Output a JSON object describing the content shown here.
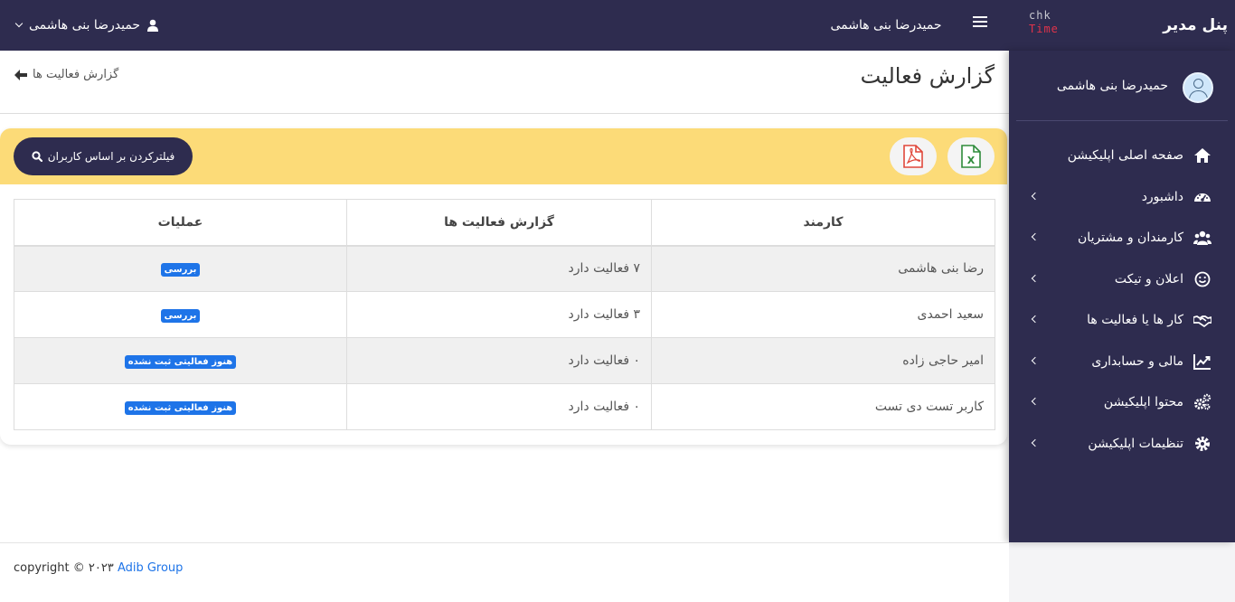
{
  "topbar": {
    "brand": "پنل مدیر",
    "logo_line1": "chk",
    "logo_line2": "Time",
    "user_name": "حمیدرضا بنی هاشمی",
    "user_menu_name": "حمیدرضا بنی هاشمی"
  },
  "sidebar": {
    "profile_name": "حمیدرضا بنی هاشمی",
    "items": [
      {
        "label": "صفحه اصلی اپلیکیشن",
        "icon": "home-icon"
      },
      {
        "label": "داشبورد",
        "icon": "dashboard-icon"
      },
      {
        "label": "کارمندان و مشتریان",
        "icon": "users-icon"
      },
      {
        "label": "اعلان و تیکت",
        "icon": "smile-icon"
      },
      {
        "label": "کار ها یا فعالیت ها",
        "icon": "handshake-icon"
      },
      {
        "label": "مالی و حسابداری",
        "icon": "chart-line-icon"
      },
      {
        "label": "محتوا اپلیکیشن",
        "icon": "cogs-icon"
      },
      {
        "label": "تنظیمات اپلیکیشن",
        "icon": "gear-icon"
      }
    ]
  },
  "page": {
    "title": "گزارش فعالیت",
    "breadcrumb": "گزارش فعالیت ها"
  },
  "toolbar": {
    "filter_label": "فیلترکردن بر اساس کاربران",
    "excel_label": "X"
  },
  "table": {
    "headers": [
      "کارمند",
      "گزارش فعالیت ها",
      "عملیات"
    ],
    "rows": [
      {
        "employee": "رضا بنی هاشمی",
        "activity": "۷ فعالیت دارد",
        "action": "بررسی"
      },
      {
        "employee": "سعید احمدی",
        "activity": "۳ فعالیت دارد",
        "action": "بررسی"
      },
      {
        "employee": "امیر حاجی زاده",
        "activity": "۰ فعالیت دارد",
        "action": "هنوز فعالیتی ثبت نشده"
      },
      {
        "employee": "کاربر تست دی تست",
        "activity": "۰ فعالیت دارد",
        "action": "هنوز فعالیتی ثبت نشده"
      }
    ]
  },
  "footer": {
    "copyright": "copyright © ۲۰۲۳",
    "company": "Adib Group"
  },
  "colors": {
    "navbar": "#2e2c4f",
    "header_band": "#fcdb78",
    "badge": "#1e74e8",
    "excel_green": "#2e8b3a",
    "pdf_red": "#e0473a"
  }
}
